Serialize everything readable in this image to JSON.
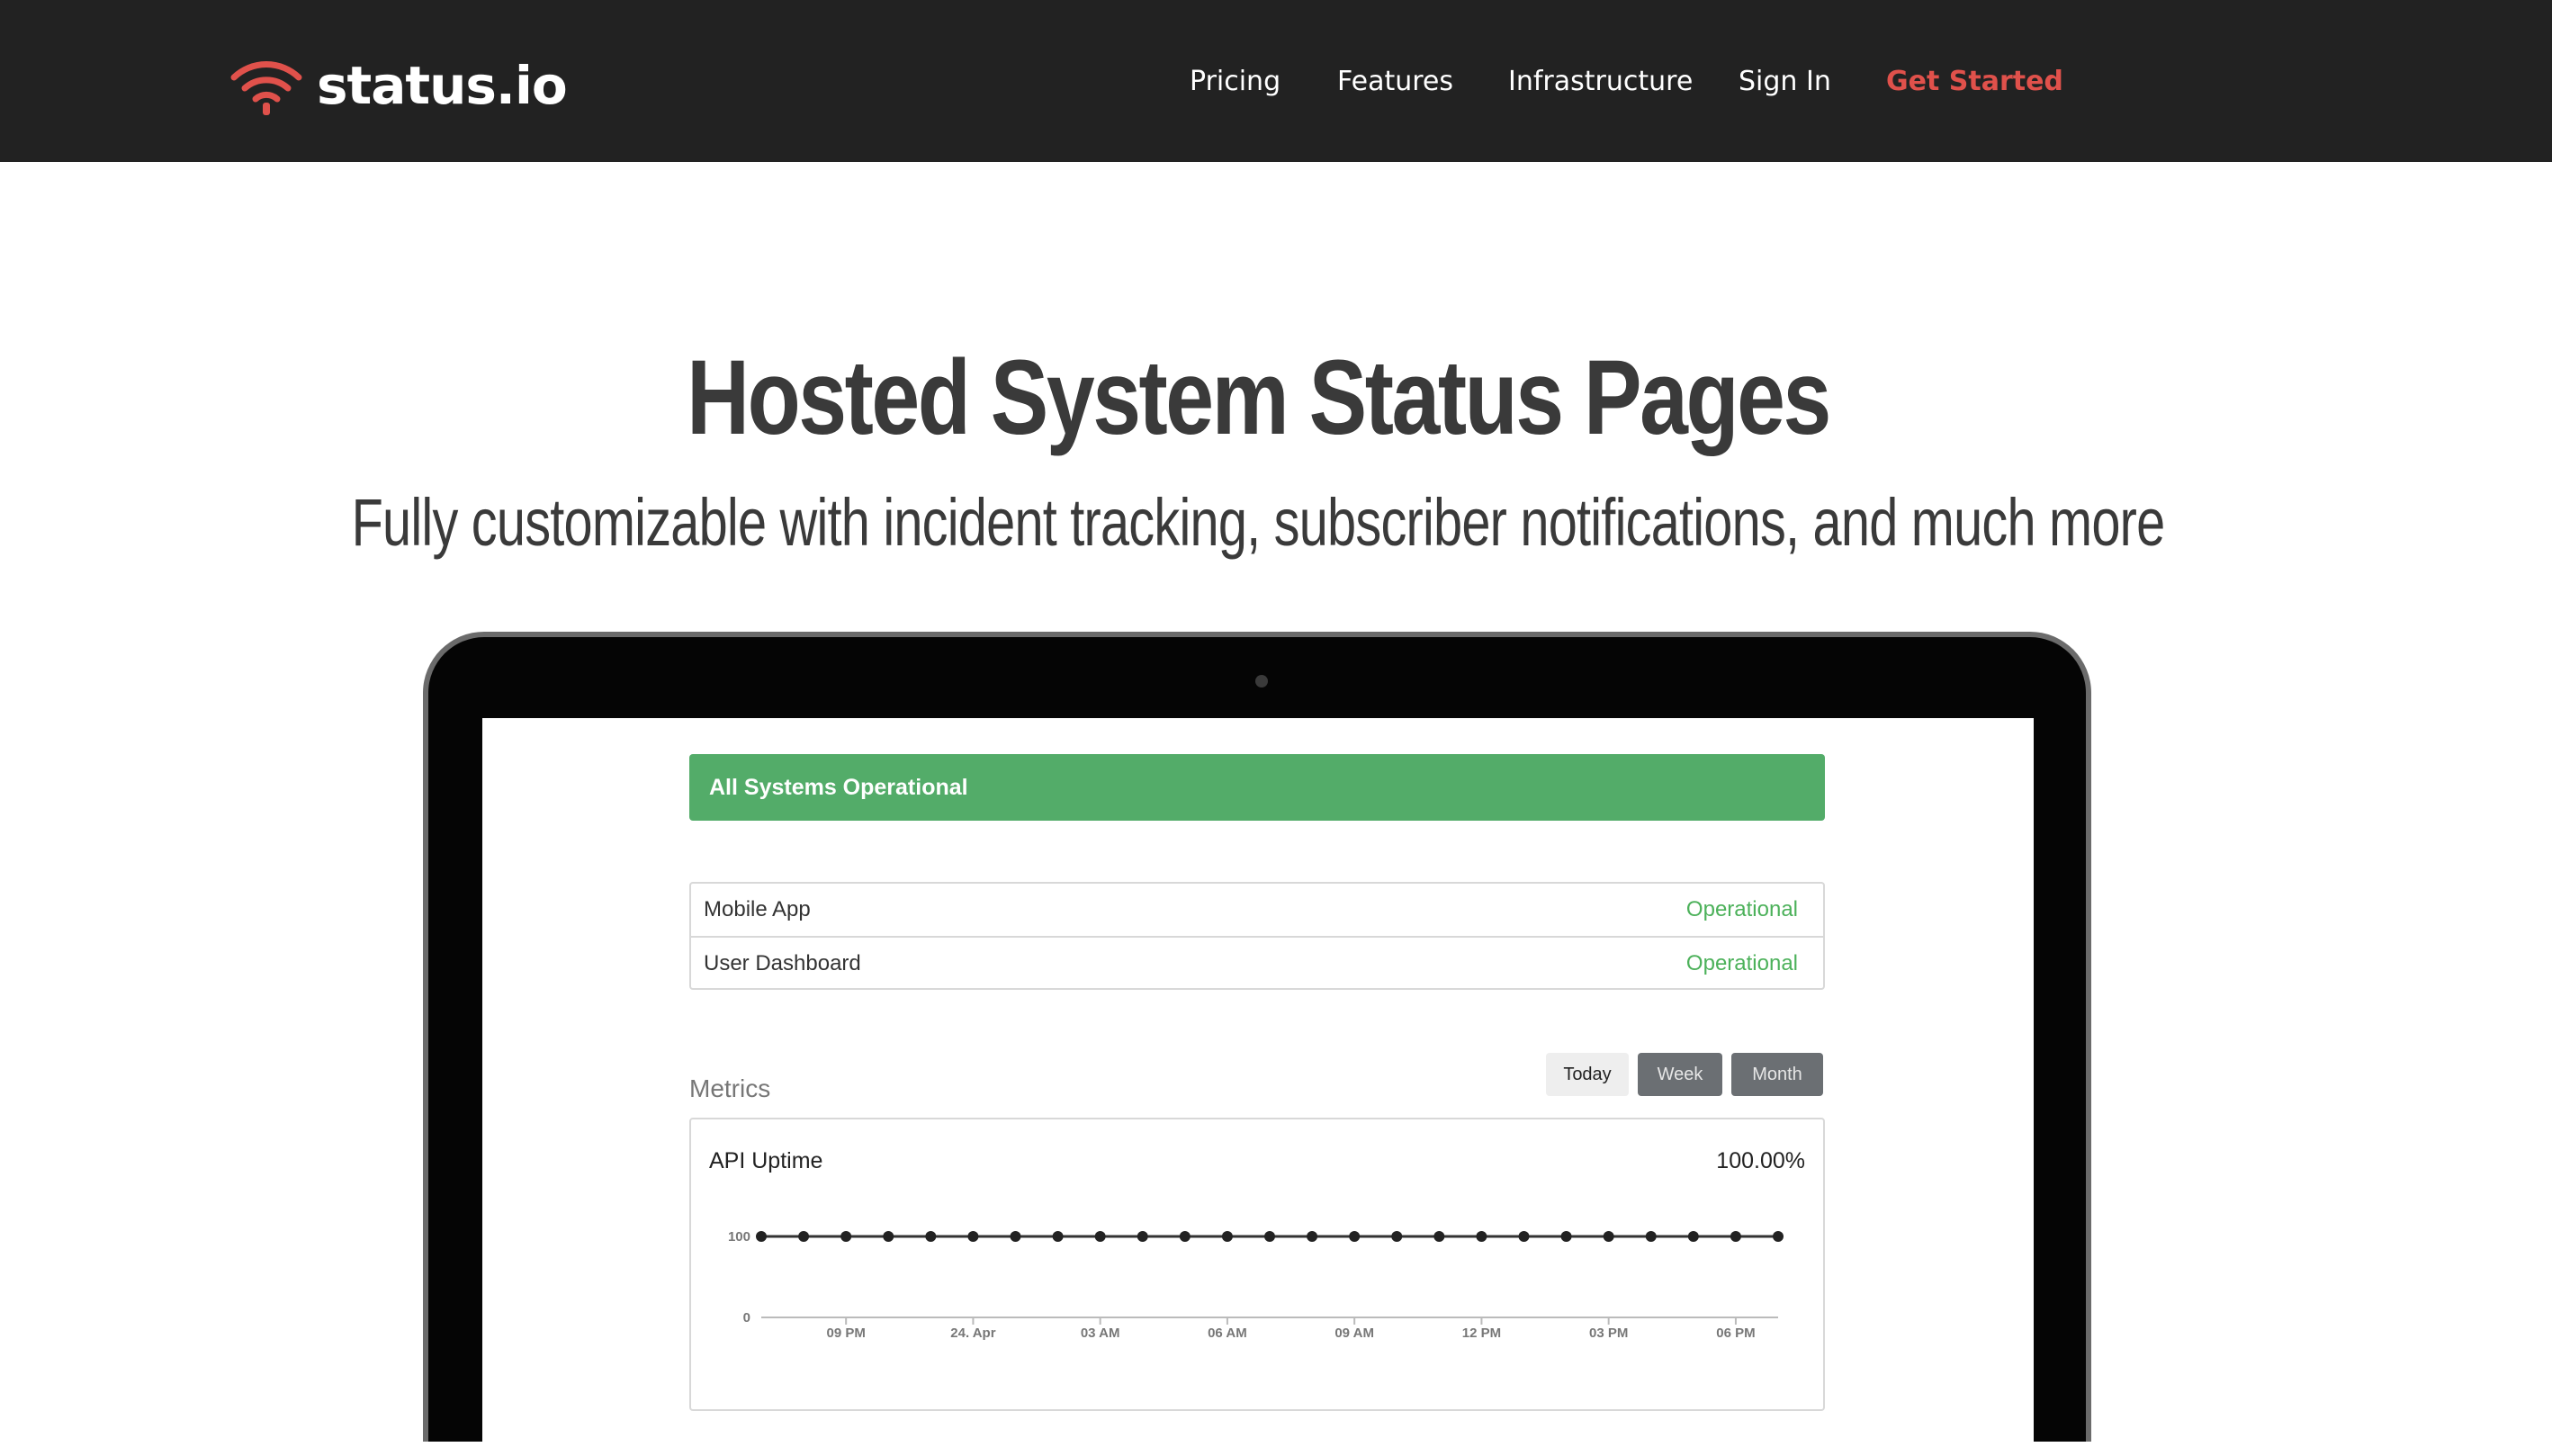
{
  "nav": {
    "brand": "status.io",
    "links": [
      {
        "label": "Pricing"
      },
      {
        "label": "Features"
      },
      {
        "label": "Infrastructure"
      },
      {
        "label": "Sign In"
      },
      {
        "label": "Get Started"
      }
    ]
  },
  "hero": {
    "title": "Hosted System Status Pages",
    "subtitle": "Fully customizable with incident tracking, subscriber notifications, and much more"
  },
  "status_page": {
    "banner": "All Systems Operational",
    "components": [
      {
        "name": "Mobile App",
        "status": "Operational"
      },
      {
        "name": "User Dashboard",
        "status": "Operational"
      }
    ],
    "metrics_label": "Metrics",
    "ranges": {
      "today": "Today",
      "week": "Week",
      "month": "Month"
    },
    "metric": {
      "name": "API Uptime",
      "value": "100.00%"
    }
  },
  "colors": {
    "nav_bg": "#222222",
    "accent_red": "#e0514b",
    "operational_green": "#53ac69",
    "status_text_green": "#4cb15a"
  },
  "chart_data": {
    "type": "line",
    "title": "API Uptime",
    "ylim": [
      0,
      100
    ],
    "y_ticks": [
      "0",
      "100"
    ],
    "x_tick_labels": [
      "09 PM",
      "24. Apr",
      "03 AM",
      "06 AM",
      "09 AM",
      "12 PM",
      "03 PM",
      "06 PM"
    ],
    "x": [
      0,
      1,
      2,
      3,
      4,
      5,
      6,
      7,
      8,
      9,
      10,
      11,
      12,
      13,
      14,
      15,
      16,
      17,
      18,
      19,
      20,
      21,
      22,
      23,
      24
    ],
    "values": [
      100,
      100,
      100,
      100,
      100,
      100,
      100,
      100,
      100,
      100,
      100,
      100,
      100,
      100,
      100,
      100,
      100,
      100,
      100,
      100,
      100,
      100,
      100,
      100,
      100
    ],
    "grid": false
  }
}
